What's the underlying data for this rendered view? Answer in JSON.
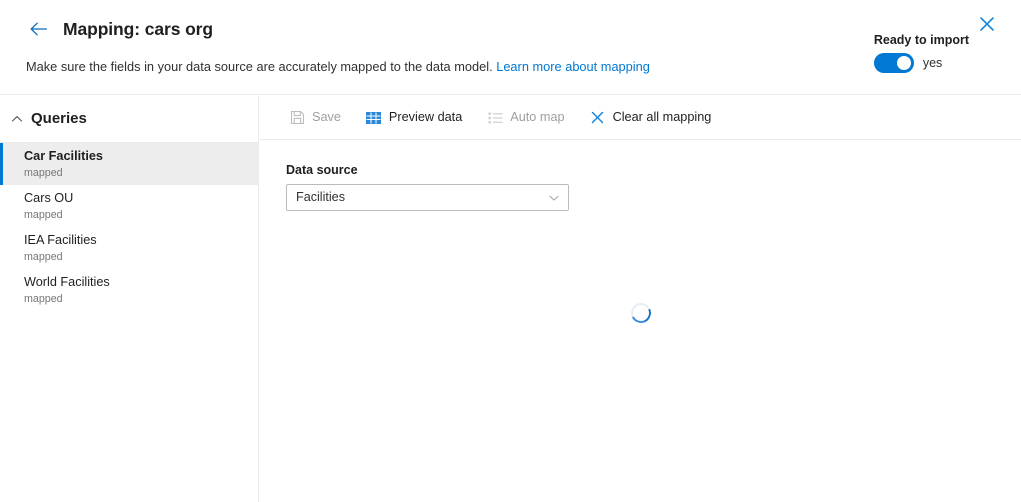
{
  "header": {
    "back_icon": "arrow-left-icon",
    "title": "Mapping: cars org",
    "subtitle_text": "Make sure the fields in your data source are accurately mapped to the data model.",
    "subtitle_link": "Learn more about mapping",
    "ready_label": "Ready to import",
    "toggle_value": "yes",
    "toggle_on": true,
    "close_icon": "close-icon",
    "accent_color": "#0078d4",
    "link_color": "#0078d4"
  },
  "sidebar": {
    "section_title": "Queries",
    "collapse_icon": "chevron-up-icon",
    "items": [
      {
        "label": "Car Facilities",
        "status": "mapped",
        "selected": true
      },
      {
        "label": "Cars OU",
        "status": "mapped",
        "selected": false
      },
      {
        "label": "IEA Facilities",
        "status": "mapped",
        "selected": false
      },
      {
        "label": "World Facilities",
        "status": "mapped",
        "selected": false
      }
    ]
  },
  "toolbar": {
    "buttons": [
      {
        "label": "Save",
        "icon": "save-icon",
        "disabled": true
      },
      {
        "label": "Preview data",
        "icon": "table-grid-icon",
        "disabled": false
      },
      {
        "label": "Auto map",
        "icon": "list-icon",
        "disabled": true
      },
      {
        "label": "Clear all mapping",
        "icon": "close-x-icon",
        "disabled": false
      }
    ]
  },
  "main": {
    "data_source_label": "Data source",
    "data_source_value": "Facilities",
    "dropdown_icon": "chevron-down-icon",
    "loading_icon": "spinner-icon"
  }
}
